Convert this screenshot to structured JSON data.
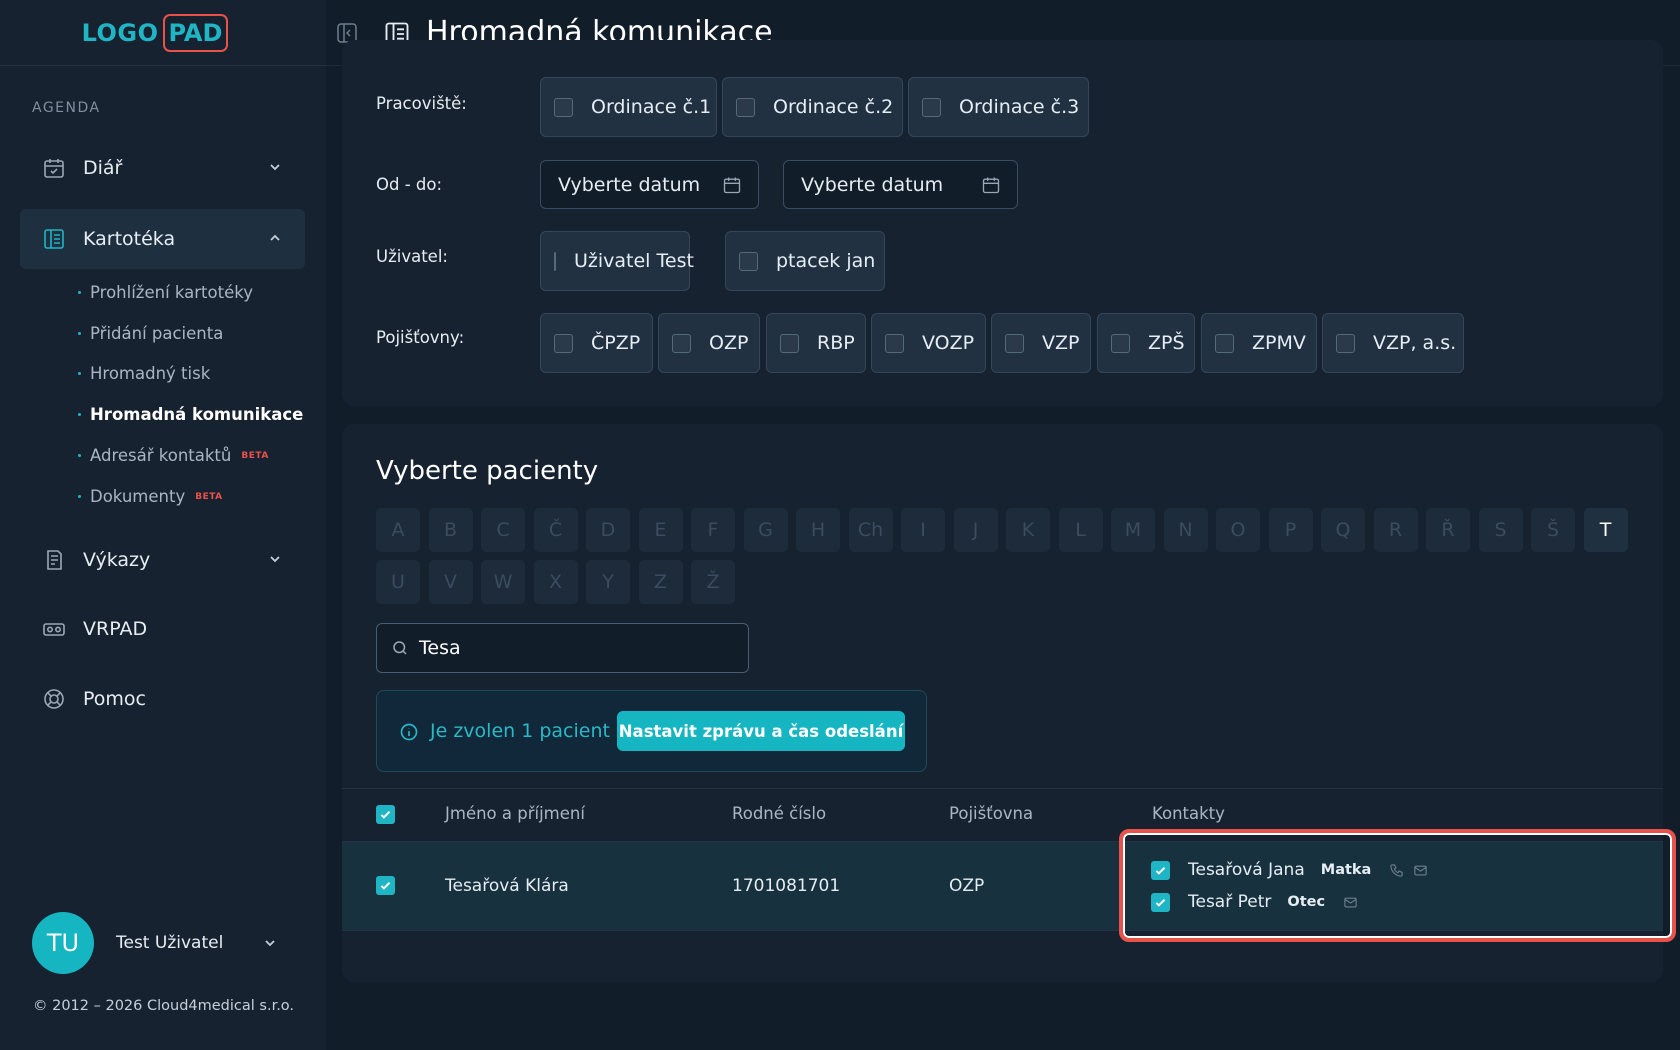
{
  "logo": {
    "left": "LOGO",
    "right": "PAD"
  },
  "sidebar": {
    "section": "AGENDA",
    "items": [
      {
        "label": "Diář"
      },
      {
        "label": "Kartotéka"
      },
      {
        "label": "Výkazy"
      },
      {
        "label": "VRPAD"
      },
      {
        "label": "Pomoc"
      }
    ],
    "subitems": [
      {
        "label": "Prohlížení kartotéky"
      },
      {
        "label": "Přidání pacienta"
      },
      {
        "label": "Hromadný tisk"
      },
      {
        "label": "Hromadná komunikace"
      },
      {
        "label": "Adresář kontaktů",
        "badge": "BETA"
      },
      {
        "label": "Dokumenty",
        "badge": "BETA"
      }
    ],
    "user": {
      "initials": "TU",
      "name": "Test Uživatel"
    },
    "copyright": "© 2012 – 2026 Cloud4medical s.r.o."
  },
  "header": {
    "title": "Hromadná komunikace"
  },
  "filters": {
    "workplace_label": "Pracoviště:",
    "workplaces": [
      "Ordinace č.1",
      "Ordinace č.2",
      "Ordinace č.3"
    ],
    "date_label": "Od - do:",
    "date_from_placeholder": "Vyberte datum",
    "date_to_placeholder": "Vyberte datum",
    "user_label": "Uživatel:",
    "users": [
      "Uživatel Test",
      "ptacek jan"
    ],
    "insurance_label": "Pojišťovny:",
    "insurances": [
      "ČPZP",
      "OZP",
      "RBP",
      "VOZP",
      "VZP",
      "ZPŠ",
      "ZPMV",
      "VZP, a.s."
    ]
  },
  "patients": {
    "title": "Vyberte pacienty",
    "letters_row1": [
      "A",
      "B",
      "C",
      "Č",
      "D",
      "E",
      "F",
      "G",
      "H",
      "Ch",
      "I",
      "J",
      "K",
      "L",
      "M",
      "N",
      "O",
      "P",
      "Q",
      "R",
      "Ř",
      "S",
      "Š",
      "T"
    ],
    "letters_row2": [
      "U",
      "V",
      "W",
      "X",
      "Y",
      "Z",
      "Ž"
    ],
    "active_letter": "T",
    "search_value": "Tesa",
    "info_text": "Je zvolen 1 pacient",
    "info_button": "Nastavit zprávu a čas odeslání",
    "columns": {
      "name": "Jméno a příjmení",
      "birth": "Rodné číslo",
      "insurance": "Pojišťovna",
      "contacts": "Kontakty"
    },
    "rows": [
      {
        "name": "Tesařová Klára",
        "birth": "1701081701",
        "insurance": "OZP",
        "contacts": [
          {
            "name": "Tesařová Jana",
            "relation": "Matka"
          },
          {
            "name": "Tesař Petr",
            "relation": "Otec"
          }
        ]
      }
    ]
  },
  "colors": {
    "accent": "#1fb5c4",
    "highlight": "#e8524a",
    "background": "#111d29",
    "panel": "#172230"
  }
}
